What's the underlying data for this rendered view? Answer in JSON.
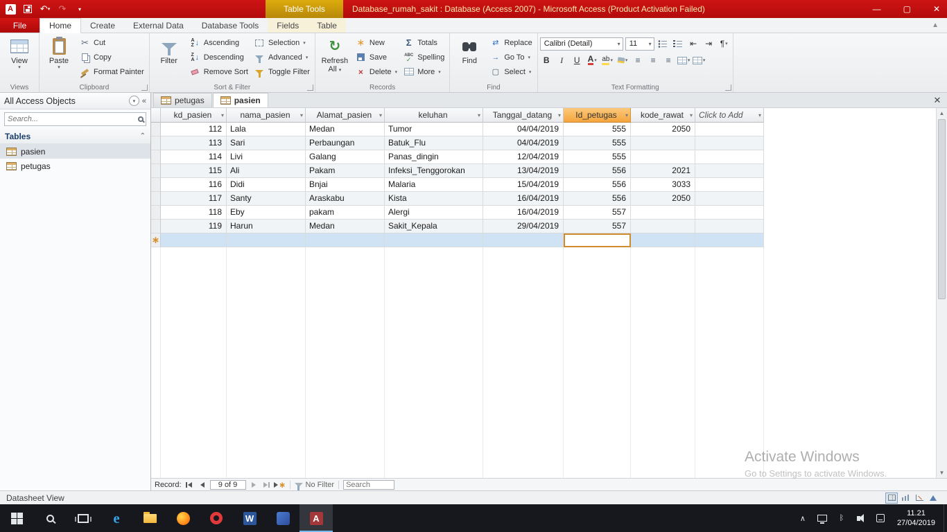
{
  "titlebar": {
    "context_header": "Table Tools",
    "title": "Database_rumah_sakit : Database (Access 2007)  -  Microsoft Access (Product Activation Failed)"
  },
  "ribbon": {
    "file_tab": "File",
    "tabs": [
      {
        "label": "Home"
      },
      {
        "label": "Create"
      },
      {
        "label": "External Data"
      },
      {
        "label": "Database Tools"
      },
      {
        "label": "Fields"
      },
      {
        "label": "Table"
      }
    ],
    "views": {
      "label": "Views",
      "view": "View"
    },
    "clipboard": {
      "label": "Clipboard",
      "paste": "Paste",
      "cut": "Cut",
      "copy": "Copy",
      "format_painter": "Format Painter"
    },
    "sort_filter": {
      "label": "Sort & Filter",
      "filter": "Filter",
      "ascending": "Ascending",
      "descending": "Descending",
      "remove_sort": "Remove Sort",
      "selection": "Selection",
      "advanced": "Advanced",
      "toggle_filter": "Toggle Filter"
    },
    "records": {
      "label": "Records",
      "refresh_line1": "Refresh",
      "refresh_line2": "All",
      "new": "New",
      "save": "Save",
      "delete": "Delete",
      "totals": "Totals",
      "spelling": "Spelling",
      "more": "More"
    },
    "find": {
      "label": "Find",
      "find": "Find",
      "replace": "Replace",
      "go_to": "Go To",
      "select": "Select"
    },
    "text_formatting": {
      "label": "Text Formatting",
      "font_name": "Calibri (Detail)",
      "font_size": "11",
      "bold": "B",
      "italic": "I",
      "underline": "U",
      "font_color_letter": "A",
      "highlight_letters": "ab"
    }
  },
  "navpane": {
    "title": "All Access Objects",
    "search_placeholder": "Search...",
    "group_label": "Tables",
    "items": [
      "pasien",
      "petugas"
    ],
    "selected_item": "pasien"
  },
  "doc": {
    "tabs": [
      "petugas",
      "pasien"
    ],
    "active_tab": "pasien"
  },
  "table": {
    "columns": [
      "kd_pasien",
      "nama_pasien",
      "Alamat_pasien",
      "keluhan",
      "Tanggal_datang",
      "Id_petugas",
      "kode_rawat",
      "Click to Add"
    ],
    "selected_column": "Id_petugas",
    "rows": [
      [
        "112",
        "Lala",
        "Medan",
        "Tumor",
        "04/04/2019",
        "555",
        "2050"
      ],
      [
        "113",
        "Sari",
        "Perbaungan",
        "Batuk_Flu",
        "04/04/2019",
        "555",
        ""
      ],
      [
        "114",
        "Livi",
        "Galang",
        "Panas_dingin",
        "12/04/2019",
        "555",
        ""
      ],
      [
        "115",
        "Ali",
        "Pakam",
        "Infeksi_Tenggorokan",
        "13/04/2019",
        "556",
        "2021"
      ],
      [
        "116",
        "Didi",
        "Bnjai",
        "Malaria",
        "15/04/2019",
        "556",
        "3033"
      ],
      [
        "117",
        "Santy",
        "Araskabu",
        "Kista",
        "16/04/2019",
        "556",
        "2050"
      ],
      [
        "118",
        "Eby",
        "pakam",
        "Alergi",
        "16/04/2019",
        "557",
        ""
      ],
      [
        "119",
        "Harun",
        "Medan",
        "Sakit_Kepala",
        "29/04/2019",
        "557",
        ""
      ]
    ]
  },
  "recordnav": {
    "label": "Record:",
    "position": "9 of 9",
    "no_filter": "No Filter",
    "search_placeholder": "Search"
  },
  "statusbar": {
    "left": "Datasheet View"
  },
  "taskbar": {
    "time": "11.21",
    "date": "27/04/2019"
  },
  "watermark": {
    "line1": "Activate Windows",
    "line2": "Go to Settings to activate Windows."
  }
}
